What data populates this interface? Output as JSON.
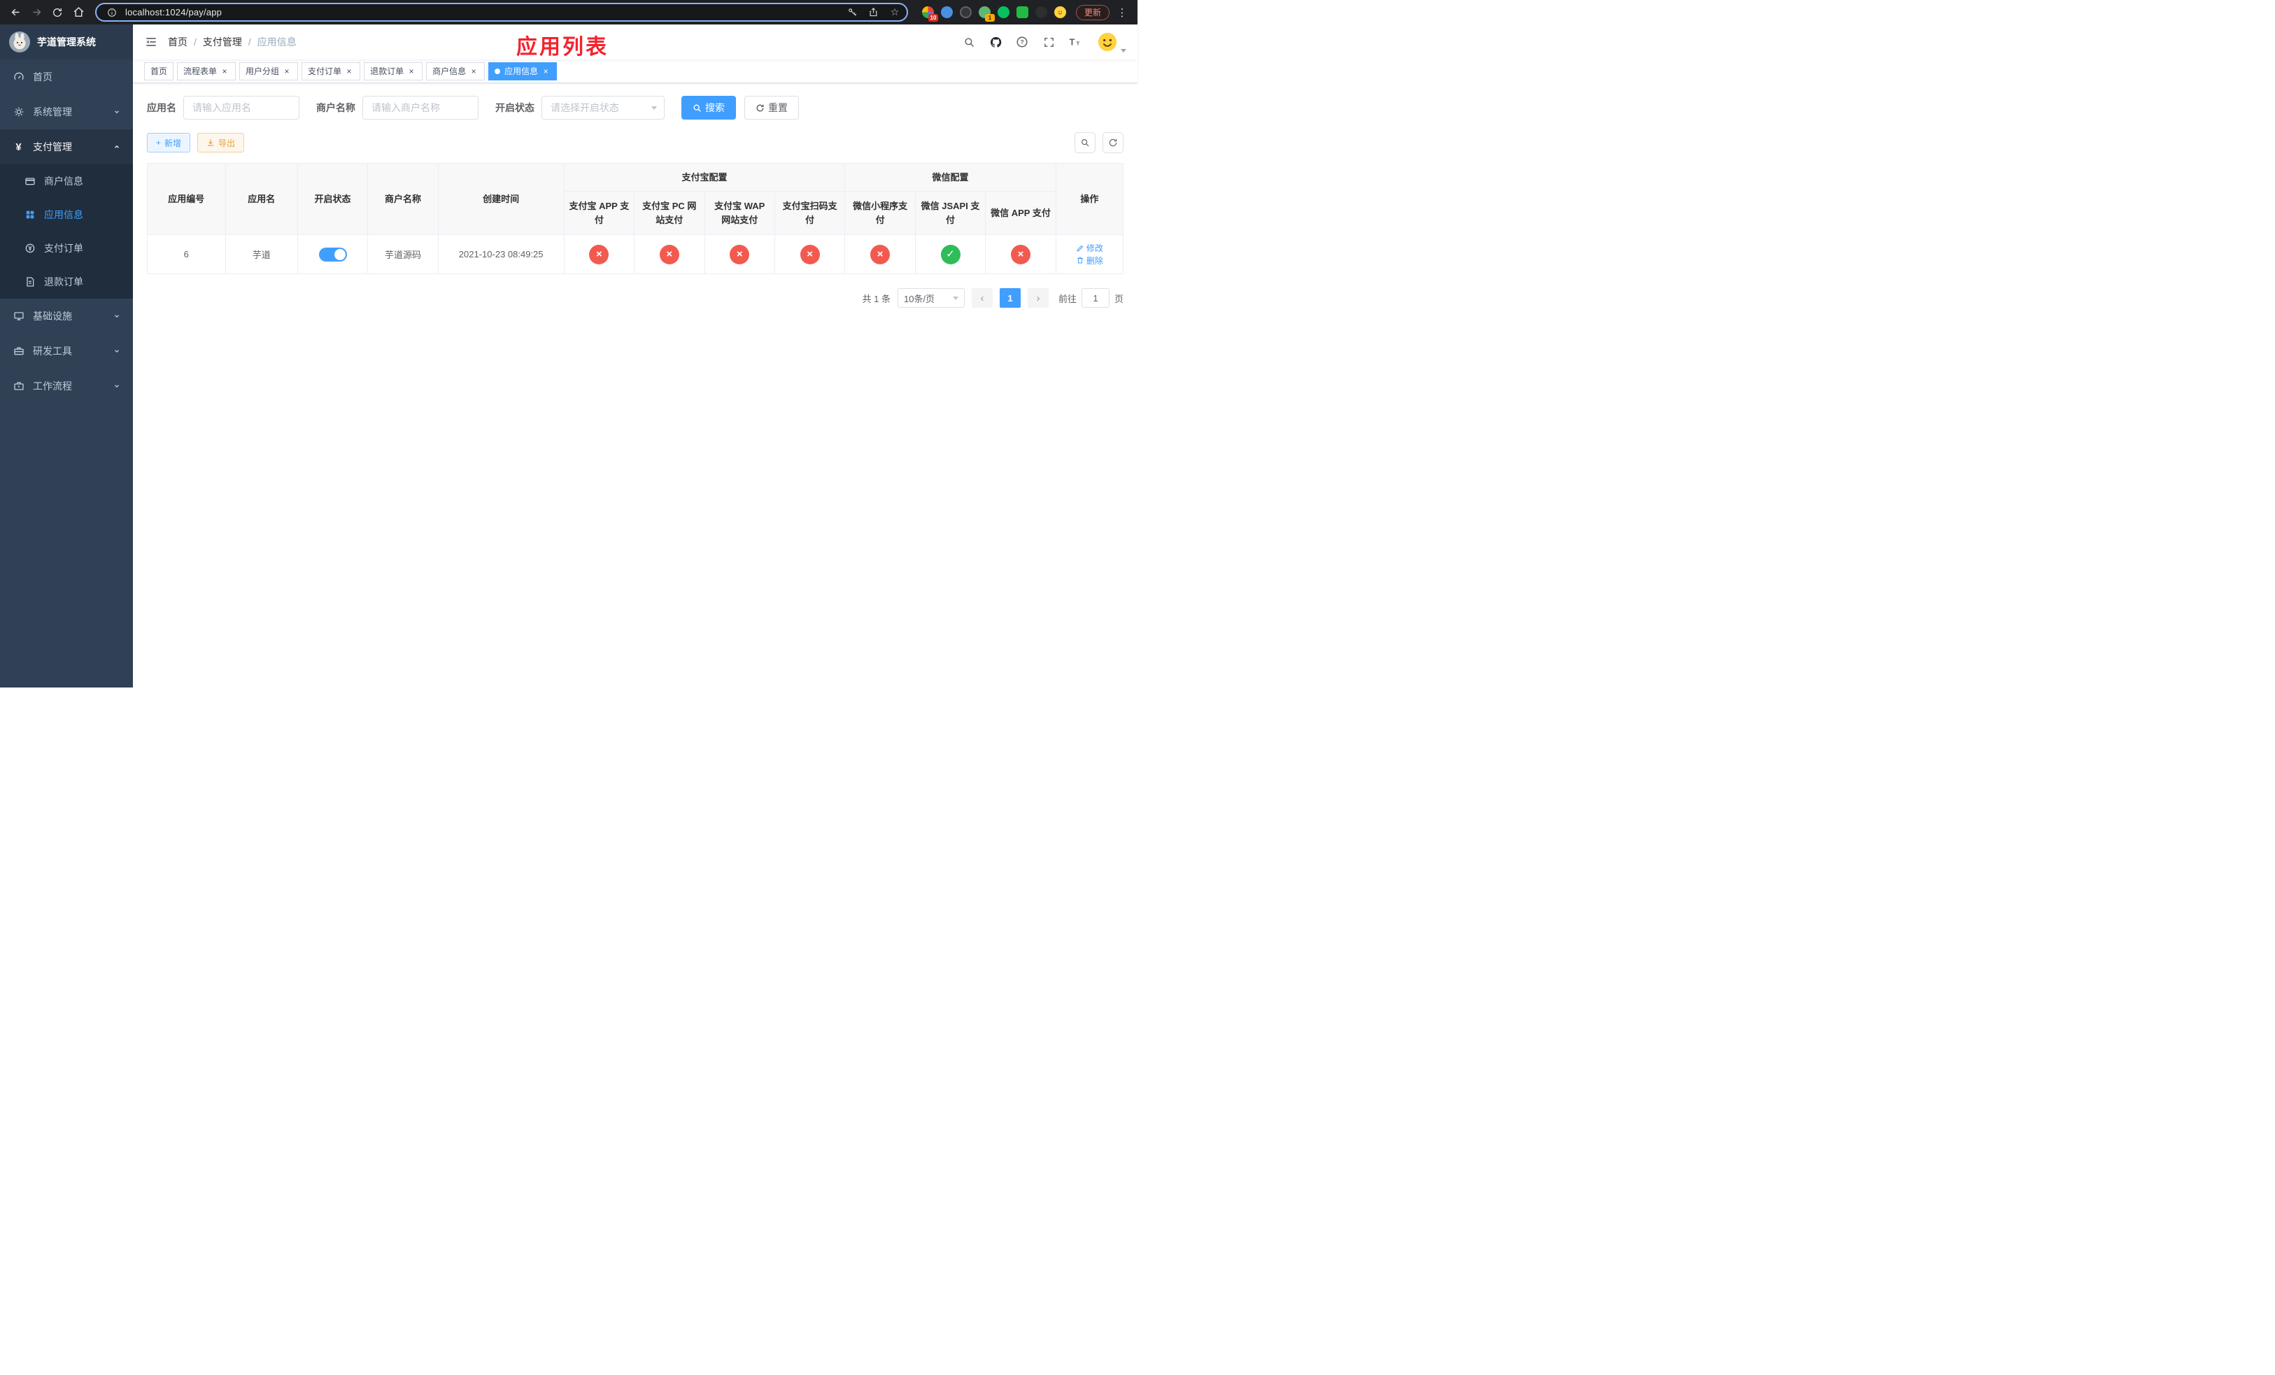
{
  "browser": {
    "url": "localhost:1024/pay/app",
    "update_label": "更新",
    "ext_badge_1": "10",
    "ext_badge_2": "1"
  },
  "sidebar": {
    "title": "芋道管理系统",
    "menu": [
      {
        "label": "首页"
      },
      {
        "label": "系统管理"
      },
      {
        "label": "支付管理"
      },
      {
        "label": "基础设施"
      },
      {
        "label": "研发工具"
      },
      {
        "label": "工作流程"
      }
    ],
    "pay_children": [
      {
        "label": "商户信息"
      },
      {
        "label": "应用信息"
      },
      {
        "label": "支付订单"
      },
      {
        "label": "退款订单"
      }
    ]
  },
  "header": {
    "breadcrumb": {
      "root": "首页",
      "section": "支付管理",
      "current": "应用信息",
      "sep": "/"
    },
    "annotation": "应用列表"
  },
  "tabs": [
    {
      "label": "首页"
    },
    {
      "label": "流程表单"
    },
    {
      "label": "用户分组"
    },
    {
      "label": "支付订单"
    },
    {
      "label": "退款订单"
    },
    {
      "label": "商户信息"
    },
    {
      "label": "应用信息"
    }
  ],
  "filters": {
    "app_name_label": "应用名",
    "app_name_placeholder": "请输入应用名",
    "merchant_label": "商户名称",
    "merchant_placeholder": "请输入商户名称",
    "status_label": "开启状态",
    "status_placeholder": "请选择开启状态",
    "search_label": "搜索",
    "reset_label": "重置"
  },
  "toolbar": {
    "add_label": "新增",
    "export_label": "导出"
  },
  "table": {
    "group_headers": {
      "alipay": "支付宝配置",
      "wechat": "微信配置"
    },
    "headers": {
      "app_id": "应用编号",
      "app_name": "应用名",
      "status": "开启状态",
      "merchant": "商户名称",
      "created": "创建时间",
      "ops": "操作",
      "alipay_app": "支付宝 APP 支付",
      "alipay_pc": "支付宝 PC 网站支付",
      "alipay_wap": "支付宝 WAP 网站支付",
      "alipay_qr": "支付宝扫码支付",
      "wx_lite": "微信小程序支付",
      "wx_jsapi": "微信 JSAPI 支付",
      "wx_app": "微信 APP 支付"
    },
    "rows": [
      {
        "app_id": "6",
        "app_name": "芋道",
        "enabled": true,
        "merchant": "芋道源码",
        "created": "2021-10-23 08:49:25",
        "configs": [
          "no",
          "no",
          "no",
          "no",
          "no",
          "yes",
          "no"
        ],
        "edit_label": "修改",
        "delete_label": "删除"
      }
    ]
  },
  "pagination": {
    "total": "共 1 条",
    "page_size": "10条/页",
    "page": "1",
    "goto": "前往",
    "goto_value": "1",
    "unit": "页"
  },
  "icons": {
    "check": "✓",
    "cross": "×",
    "close": "×",
    "plus": "+",
    "star": "☆",
    "menu_dots": "⋮",
    "prev": "‹",
    "next": "›",
    "yen": "¥"
  },
  "colors": {
    "primary": "#409eff",
    "danger": "#f25a50",
    "success": "#2ebd59",
    "annotation_red": "#f5222d",
    "sidebar_bg": "#304156",
    "sidebar_sub_bg": "#1f2d3d"
  }
}
